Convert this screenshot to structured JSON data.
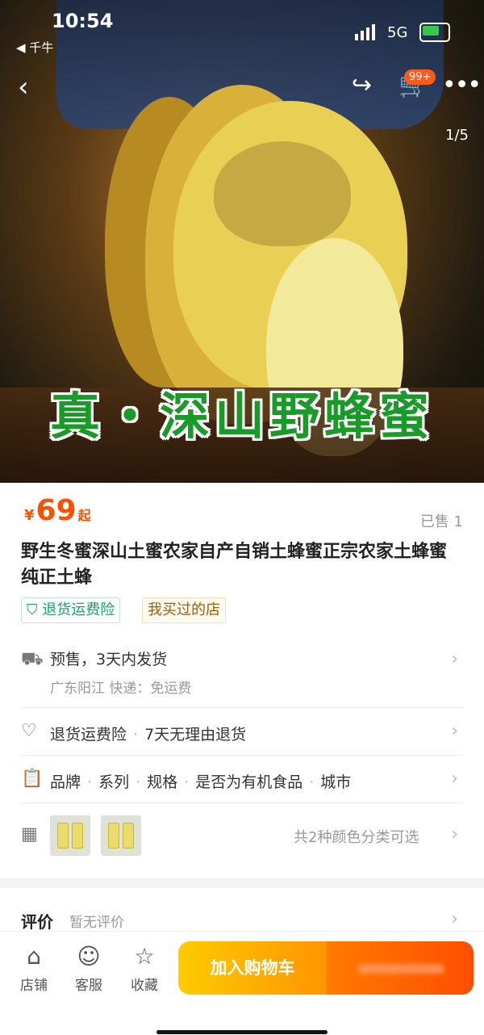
{
  "status": {
    "time": "10:54",
    "back_app": "◀ 千牛",
    "network": "5G"
  },
  "nav": {
    "back_icon": "‹",
    "share_icon": "↪",
    "cart_icon": "🛒",
    "cart_badge": "99+",
    "more_icon": "•••"
  },
  "gallery": {
    "banner_text": "真・深山野蜂蜜",
    "page_indicator": "1/5"
  },
  "product": {
    "currency": "¥",
    "price": "69",
    "price_suffix": "起",
    "sold": "已售 1",
    "title": "野生冬蜜深山土蜜农家自产自销土蜂蜜正宗农家土蜂蜜纯正土蜂",
    "tags": [
      "退货运费险",
      "我买过的店"
    ]
  },
  "rows": {
    "shipping": {
      "title": "预售，3天内发货",
      "sub": "广东阳江 快递：免运费"
    },
    "guarantee": {
      "a": "退货运费险",
      "b": "7天无理由退货"
    },
    "params": {
      "items": [
        "品牌",
        "系列",
        "规格",
        "是否为有机食品",
        "城市"
      ]
    },
    "sku": {
      "summary": "共2种颜色分类可选"
    }
  },
  "review": {
    "label": "评价",
    "none": "暂无评价"
  },
  "bottom": {
    "shop": "店铺",
    "service": "客服",
    "favorite": "收藏",
    "add_cart": "加入购物车"
  },
  "colors": {
    "price": "#ff5000",
    "accent_green": "#17a56b",
    "cart_start": "#ffcb00",
    "buy_end": "#ff4e00"
  }
}
